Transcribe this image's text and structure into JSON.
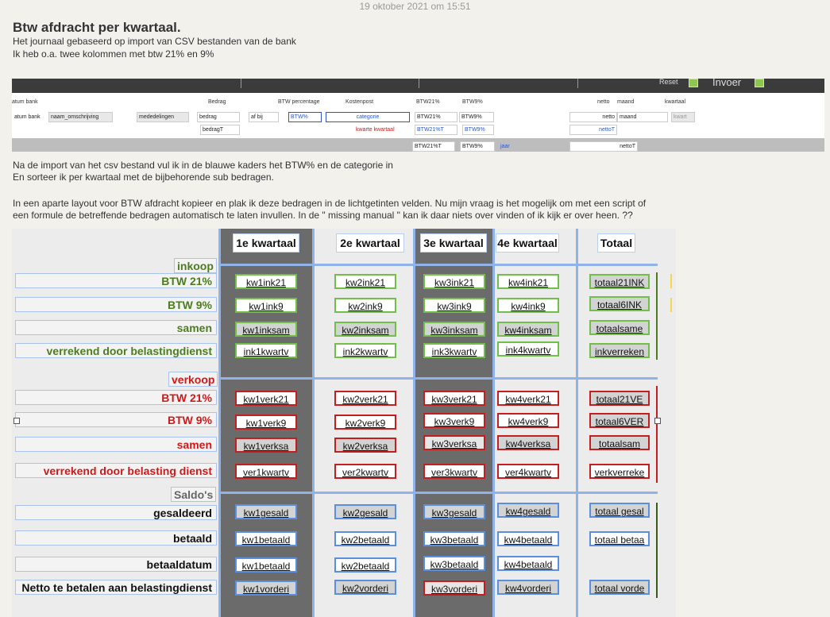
{
  "timestamp": "19 oktober 2021 om 15:51",
  "title": "Btw afdracht per kwartaal.",
  "intro": [
    "Het journaal  gebaseerd op import van CSV bestanden van de bank",
    "Ik heb o.a. twee kolommen met btw 21% en 9%"
  ],
  "middle_text": [
    "Na de import van het csv bestand vul ik  in de blauwe kaders het BTW% en de categorie in",
    "En sorteer ik per kwartaal met de  bijbehorende sub bedragen."
  ],
  "question_text": [
    "In een aparte layout voor BTW afdracht kopieer en plak ik deze bedragen in de lichtgetinten velden. Nu mijn vraag is het mogelijk om met een script of",
    "een formule de betreffende bedragen automatisch te laten invullen. In de \" missing manual \" kan ik daar niets over vinden of ik kijk er over heen.  ??"
  ],
  "strip": {
    "reset": "Reset",
    "invoer": "Invoer",
    "headers": [
      "atum bank",
      "Bedrag",
      "BTW percentage",
      "Kostenpost",
      "BTW21%",
      "BTW9%",
      "netto",
      "maand",
      "kwartaal"
    ],
    "row1": [
      "atum bank",
      "naam_omschrijving",
      "mededelingen",
      "bedrag",
      "af bij",
      "BTW%",
      "categorie",
      "BTW21%",
      "BTW9%",
      "netto",
      "maand",
      "kwart"
    ],
    "row2": [
      "bedragT",
      "kwarte kwartaal",
      "BTW21%T",
      "BTW9%",
      "nettoT"
    ],
    "row3": [
      "BTW21%T",
      "BTW9%",
      "jaar",
      "nettoT"
    ]
  },
  "columns": [
    "1e kwartaal",
    "2e kwartaal",
    "3e kwartaal",
    "4e kwartaal",
    "Totaal"
  ],
  "sections": {
    "inkoop": "inkoop",
    "verkoop": "verkoop",
    "saldos": "Saldo's"
  },
  "inkoop_rows": [
    {
      "label": "BTW 21%",
      "cells": [
        "kw1ink21",
        "kw2ink21",
        "kw3ink21",
        "kw4ink21",
        "totaal21INK"
      ]
    },
    {
      "label": "BTW 9%",
      "cells": [
        "kw1ink9",
        "kw2ink9",
        "kw3ink9",
        "kw4ink9",
        "totaal6INK"
      ]
    },
    {
      "label": "samen",
      "cells": [
        "kw1inksam",
        "kw2inksam",
        "kw3inksam",
        "kw4inksam",
        "totaalsame"
      ]
    },
    {
      "label": "verrekend door belastingdienst",
      "cells": [
        "ink1kwartv",
        "ink2kwartv",
        "ink3kwartv",
        "ink4kwartv",
        "inkverreken"
      ]
    }
  ],
  "verkoop_rows": [
    {
      "label": "BTW 21%",
      "cells": [
        "kw1verk21",
        "kw2verk21",
        "kw3verk21",
        "kw4verk21",
        "totaal21VE"
      ]
    },
    {
      "label": "BTW 9%",
      "cells": [
        "kw1verk9",
        "kw2verk9",
        "kw3verk9",
        "kw4verk9",
        "totaal6VER"
      ]
    },
    {
      "label": "samen",
      "cells": [
        "kw1verksa",
        "kw2verksa",
        "kw3verksa",
        "kw4verksa",
        "totaalsam"
      ]
    },
    {
      "label": "verrekend door belasting dienst",
      "cells": [
        "ver1kwartv",
        "ver2kwartv",
        "ver3kwartv",
        "ver4kwartv",
        "verkverreke"
      ]
    }
  ],
  "saldo_rows": [
    {
      "label": "gesaldeerd",
      "cells": [
        "kw1gesald",
        "kw2gesald",
        "kw3gesald",
        "kw4gesald",
        "totaal gesal"
      ]
    },
    {
      "label": "betaald",
      "cells": [
        "kw1betaald",
        "kw2betaald",
        "kw3betaald",
        "kw4betaald",
        "totaal betaa"
      ]
    },
    {
      "label": "betaaldatum",
      "cells": [
        "kw1betaald",
        "kw2betaald",
        "kw3betaald",
        "kw4betaald"
      ]
    },
    {
      "label": "Netto te betalen aan belastingdienst",
      "cells": [
        "kw1vorderi",
        "kw2vorderi",
        "kw3vorderi",
        "kw4vorderi",
        "totaal vorde"
      ]
    }
  ]
}
